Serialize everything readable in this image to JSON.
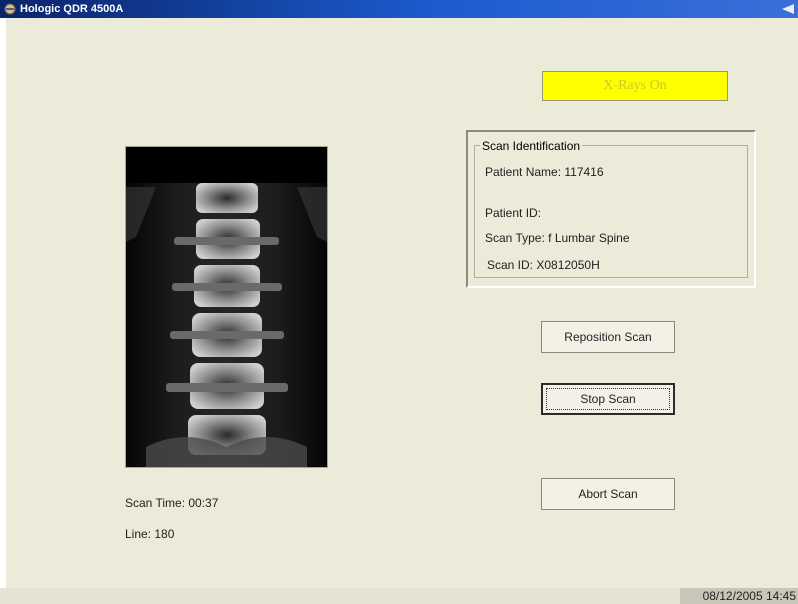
{
  "window": {
    "title": "Hologic QDR 4500A"
  },
  "xray_indicator": {
    "label": "X-Rays On"
  },
  "scan_identification": {
    "legend": "Scan Identification",
    "patient_name": "Patient Name:  117416",
    "patient_id": "Patient ID:",
    "scan_type": "Scan Type: f Lumbar Spine",
    "scan_id": "Scan ID: X0812050H"
  },
  "buttons": {
    "reposition": "Reposition Scan",
    "stop": "Stop Scan",
    "abort": "Abort Scan"
  },
  "scan_status": {
    "scan_time": "Scan Time: 00:37",
    "line": "Line: 180"
  },
  "status_bar": {
    "datetime": "08/12/2005 14:45"
  },
  "colors": {
    "accent_yellow": "#ffff00",
    "panel_bg": "#ecead9",
    "titlebar_blue": "#1c5ccf"
  },
  "icons": [
    "app-icon",
    "window-corner-icon"
  ]
}
